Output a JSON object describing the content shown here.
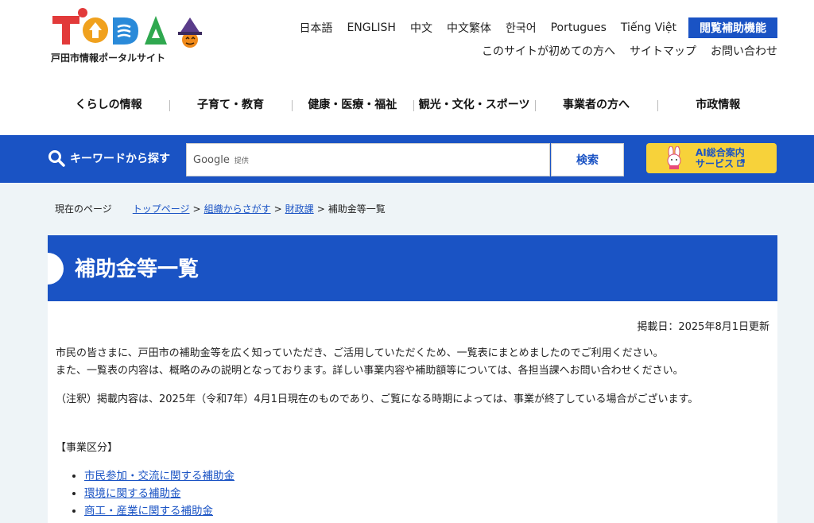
{
  "logo": {
    "text": "TODA",
    "subtitle": "戸田市情報ポータルサイト"
  },
  "languages": [
    "日本語",
    "ENGLISH",
    "中文",
    "中文繁体",
    "한국어",
    "Portugues",
    "Tiếng Việt"
  ],
  "accessibility_button": "閲覧補助機能",
  "sublinks": [
    "このサイトが初めての方へ",
    "サイトマップ",
    "お問い合わせ"
  ],
  "main_nav": [
    "くらしの情報",
    "子育て・教育",
    "健康・医療・福祉",
    "観光・文化・スポーツ",
    "事業者の方へ",
    "市政情報"
  ],
  "search": {
    "label": "キーワードから探す",
    "provider": "Google",
    "provider_suffix": "提供",
    "button": "検索"
  },
  "ai_service": {
    "line1": "AI総合案内",
    "line2": "サービス"
  },
  "breadcrumb": {
    "here_label": "現在のページ",
    "links": [
      "トップページ",
      "組織からさがす",
      "財政課"
    ],
    "current": "補助金等一覧"
  },
  "page": {
    "title": "補助金等一覧",
    "updated": "掲載日：2025年8月1日更新",
    "p1_line1": "市民の皆さまに、戸田市の補助金等を広く知っていただき、ご活用していただくため、一覧表にまとめましたのでご利用ください。",
    "p1_line2": "また、一覧表の内容は、概略のみの説明となっております。詳しい事業内容や補助額等については、各担当課へお問い合わせください。",
    "p2": "（注釈）掲載内容は、2025年（令和7年）4月1日現在のものであり、ご覧になる時期によっては、事業が終了している場合がございます。",
    "section_head": "【事業区分】",
    "categories": [
      "市民参加・交流に関する補助金",
      "環境に関する補助金",
      "商工・産業に関する補助金"
    ]
  },
  "colors": {
    "brand_blue": "#1a53c4",
    "ai_yellow": "#f7d23a",
    "page_bg": "#eef4f7"
  }
}
